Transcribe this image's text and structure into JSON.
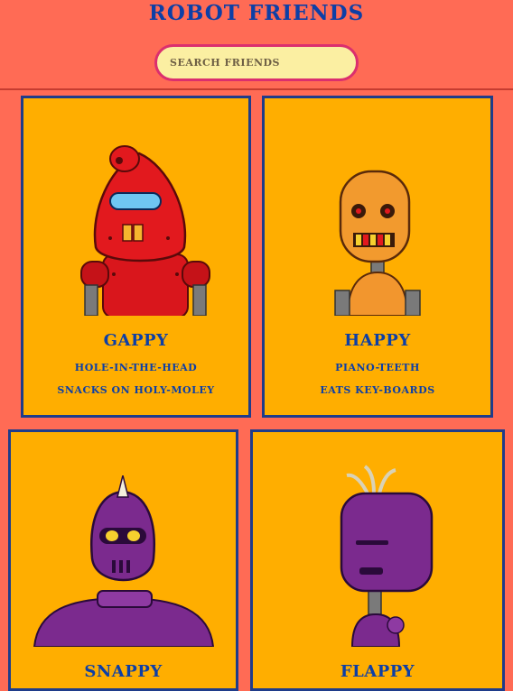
{
  "header": {
    "title": "ROBOT FRIENDS",
    "search_placeholder": "SEARCH FRIENDS"
  },
  "robots": [
    {
      "name": "GAPPY",
      "line1": "HOLE-IN-THE-HEAD",
      "line2": "SNACKS ON HOLY-MOLEY",
      "color": "#D9161C"
    },
    {
      "name": "HAPPY",
      "line1": "PIANO-TEETH",
      "line2": "EATS KEY-BOARDS",
      "color": "#F2962E"
    },
    {
      "name": "SNAPPY",
      "line1": "",
      "line2": "",
      "color": "#7B2A8E"
    },
    {
      "name": "FLAPPY",
      "line1": "",
      "line2": "",
      "color": "#7B2A8E"
    }
  ],
  "icons": [
    "robot-gappy-icon",
    "robot-happy-icon",
    "robot-snappy-icon",
    "robot-flappy-icon",
    "search-field"
  ],
  "colors": {
    "background": "#FF6B55",
    "card": "#FFAE00",
    "card_border": "#1F3C8A",
    "text": "#0D3FA6",
    "search_bg": "#FBEFA2",
    "search_border": "#DB2F6E"
  }
}
